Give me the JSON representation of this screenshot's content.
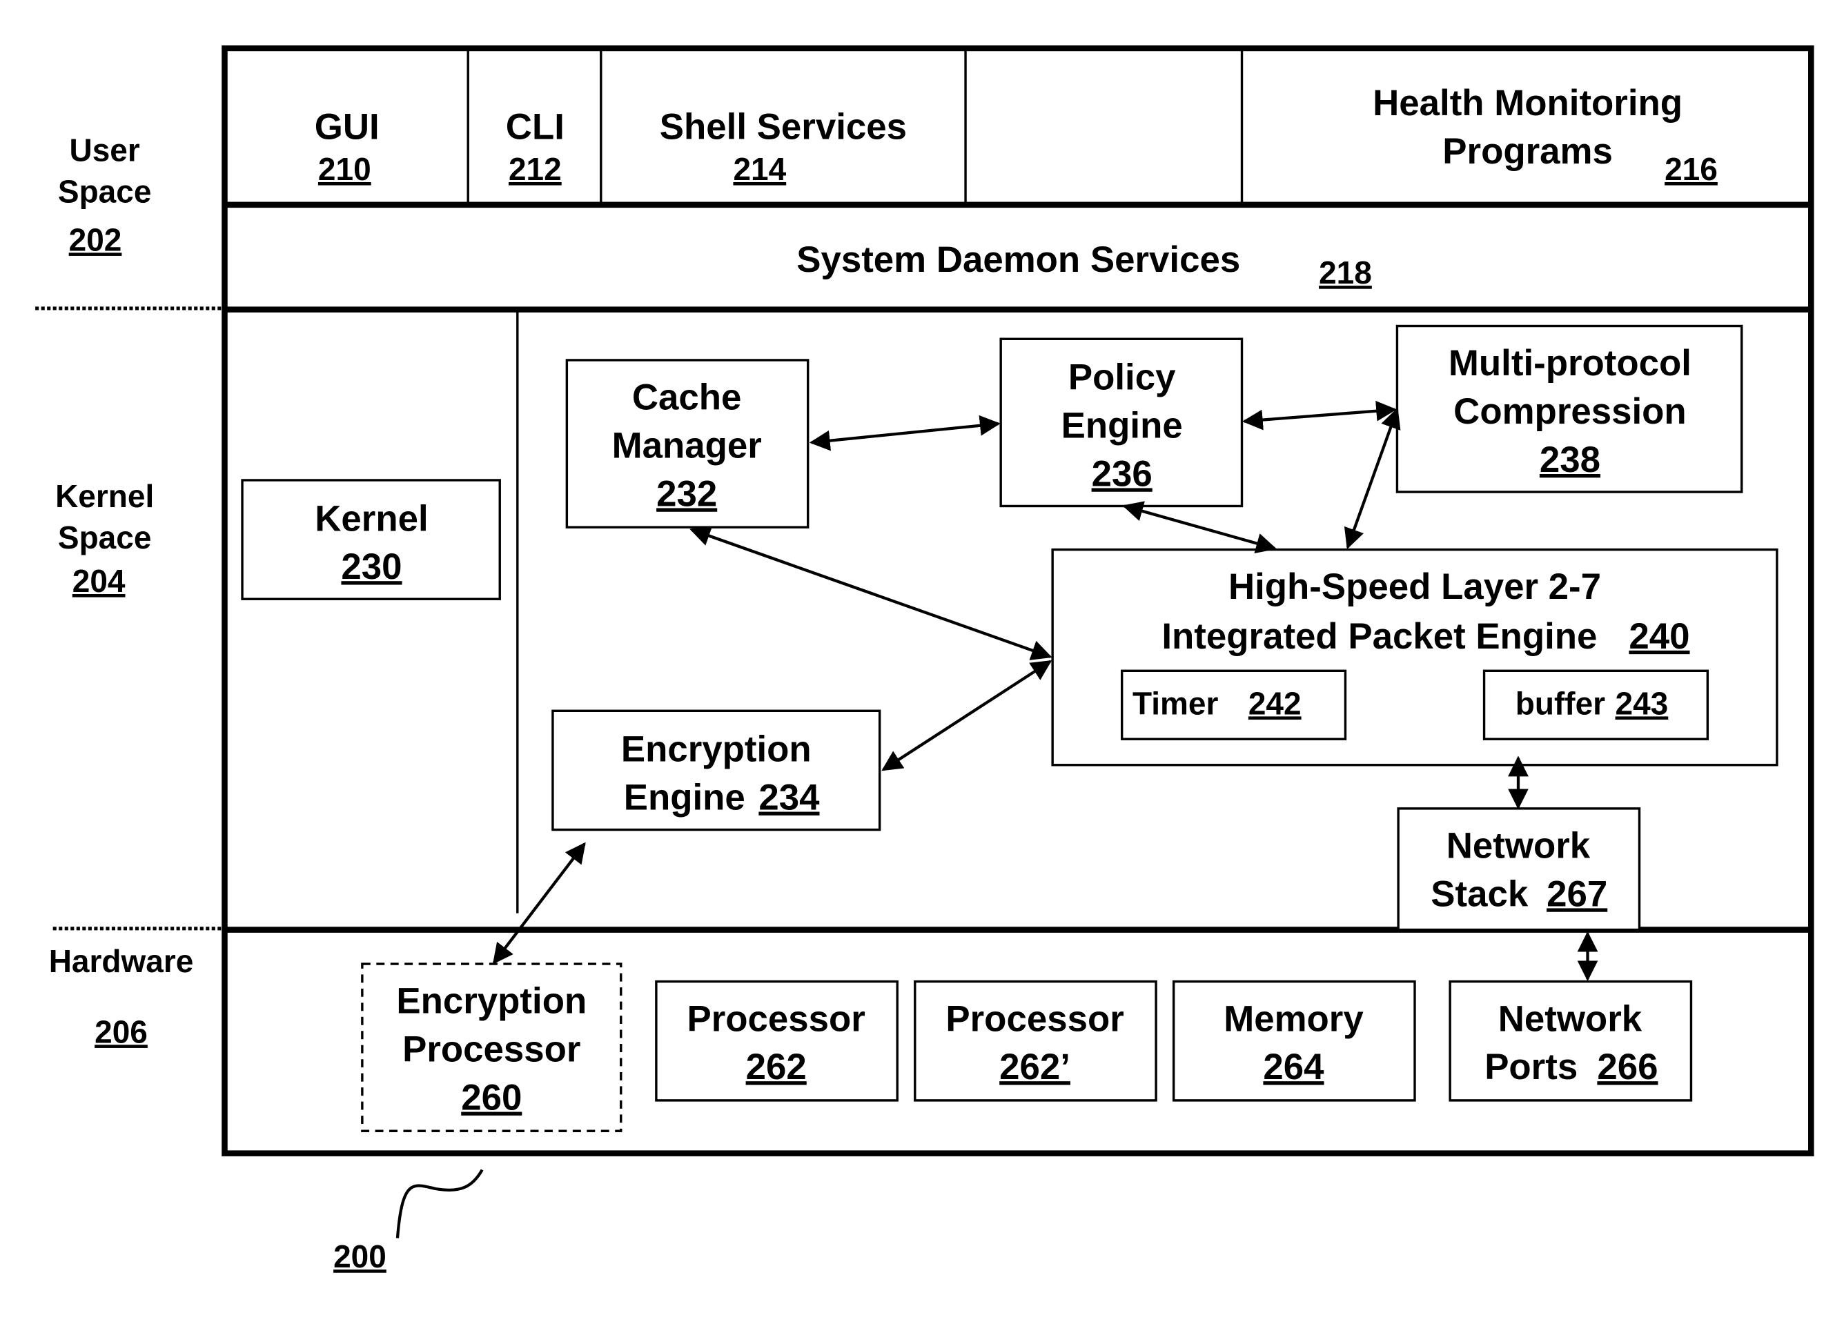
{
  "figure": {
    "reference_numeral": "200"
  },
  "side_labels": {
    "user_space": {
      "line1": "User",
      "line2": "Space",
      "numeral": "202"
    },
    "kernel_space": {
      "line1": "Kernel",
      "line2": "Space",
      "numeral": "204"
    },
    "hardware": {
      "line1": "Hardware",
      "numeral": "206"
    }
  },
  "user_space": {
    "gui": {
      "label": "GUI",
      "numeral": "210"
    },
    "cli": {
      "label": "CLI",
      "numeral": "212"
    },
    "shell_services": {
      "label": "Shell Services",
      "numeral": "214"
    },
    "health_monitoring": {
      "line1": "Health Monitoring",
      "line2": "Programs",
      "numeral": "216"
    },
    "system_daemon": {
      "label": "System Daemon Services",
      "numeral": "218"
    }
  },
  "kernel_space": {
    "kernel": {
      "label": "Kernel",
      "numeral": "230"
    },
    "cache_manager": {
      "line1": "Cache",
      "line2": "Manager",
      "numeral": "232"
    },
    "encryption_engine": {
      "line1": "Encryption",
      "line2": "Engine",
      "numeral": "234"
    },
    "policy_engine": {
      "line1": "Policy",
      "line2": "Engine",
      "numeral": "236"
    },
    "compression": {
      "line1": "Multi-protocol",
      "line2": "Compression",
      "numeral": "238"
    },
    "packet_engine": {
      "line1": "High-Speed Layer 2-7",
      "line2": "Integrated Packet Engine",
      "numeral": "240"
    },
    "timer": {
      "label": "Timer",
      "numeral": "242"
    },
    "buffer": {
      "label": "buffer",
      "numeral": "243"
    },
    "network_stack": {
      "line1": "Network",
      "line2": "Stack",
      "numeral": "267"
    }
  },
  "hardware": {
    "encryption_processor": {
      "line1": "Encryption",
      "line2": "Processor",
      "numeral": "260"
    },
    "processor_a": {
      "label": "Processor",
      "numeral": "262"
    },
    "processor_b": {
      "label": "Processor",
      "numeral": "262’"
    },
    "memory": {
      "label": "Memory",
      "numeral": "264"
    },
    "network_ports": {
      "line1": "Network",
      "line2": "Ports",
      "numeral": "266"
    }
  }
}
